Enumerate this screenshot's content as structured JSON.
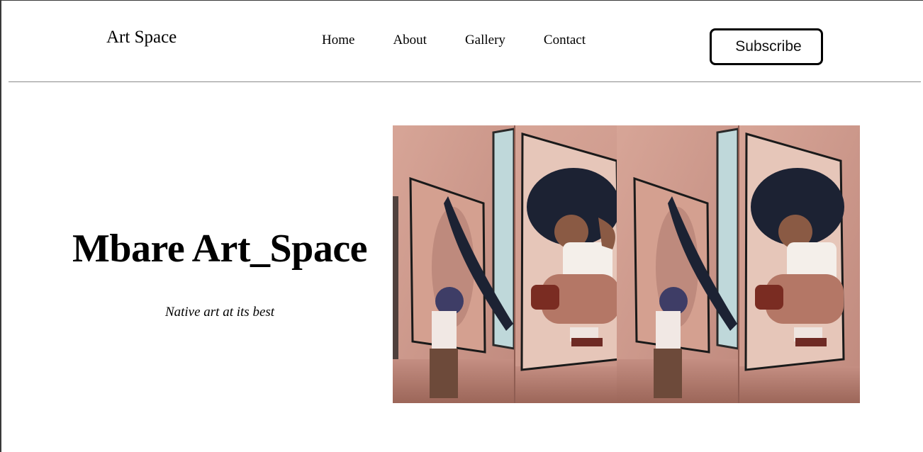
{
  "header": {
    "brand": "Art Space",
    "nav": [
      "Home",
      "About",
      "Gallery",
      "Contact"
    ],
    "subscribe_label": "Subscribe"
  },
  "hero": {
    "title": "Mbare Art_Space",
    "subtitle": "Native art at its best",
    "image_icon": "art-collage-image"
  },
  "colors": {
    "wall": "#d9a89a",
    "wall_dark": "#a8746a",
    "hair": "#1c2233",
    "frame": "#1a1a1a"
  }
}
